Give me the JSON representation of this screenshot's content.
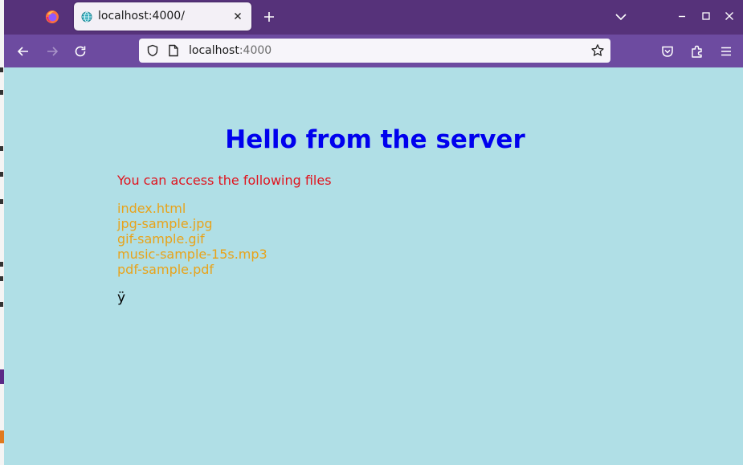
{
  "browser": {
    "tab_title": "localhost:4000/",
    "url_host": "localhost",
    "url_port": ":4000",
    "colors": {
      "tabbar": "#56327a",
      "navbar": "#6d4ba0",
      "page_background": "#b0dfe6"
    }
  },
  "page": {
    "heading": "Hello from the server",
    "intro": "You can access the following files",
    "files": [
      "index.html",
      "jpg-sample.jpg",
      "gif-sample.gif",
      "music-sample-15s.mp3",
      "pdf-sample.pdf"
    ],
    "trailing_char": "ÿ",
    "colors": {
      "heading": "#0000ee",
      "intro": "#e0141e",
      "files": "#e8a31a"
    }
  },
  "icons": {
    "app": "firefox-icon",
    "favicon": "globe-icon",
    "toolbar": [
      "back-icon",
      "forward-icon",
      "reload-icon",
      "pocket-icon",
      "extensions-icon",
      "menu-icon"
    ]
  }
}
